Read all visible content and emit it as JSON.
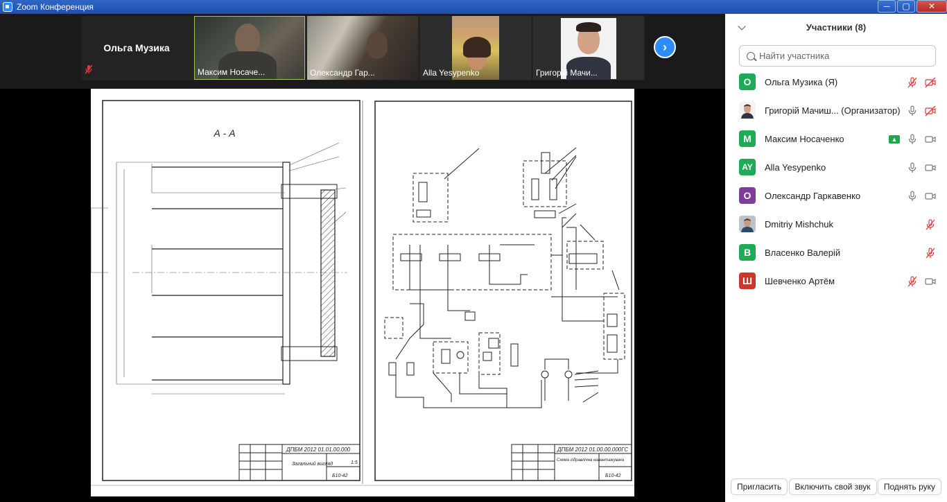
{
  "window": {
    "title": "Zoom Конференция",
    "min": "─",
    "max": "▢",
    "close": "✕"
  },
  "strip": {
    "self_name": "Ольга Музика",
    "tiles": [
      {
        "name": "Максим Носаче..."
      },
      {
        "name": "Олександр Гар..."
      },
      {
        "name": "Alla Yesypenko"
      },
      {
        "name": "Григорій Мачи..."
      }
    ],
    "next_arrow": "›"
  },
  "share": {
    "left_sheet": {
      "section_label": "А - А",
      "stamp_code": "ДПБМ 2012 01.01.00.000",
      "stamp_title": "Загальний вигляд",
      "stamp_scale": "1:5",
      "stamp_group": "Б10-42"
    },
    "right_sheet": {
      "stamp_code": "ДПБМ 2012 01.00.00.000ГС",
      "stamp_title": "Схема гідравлічна навантажувача",
      "stamp_group": "Б10-42"
    }
  },
  "panel": {
    "title": "Участники (8)",
    "search_placeholder": "Найти участника",
    "participants": [
      {
        "avatar_text": "О",
        "avatar_color": "#1fab55",
        "name": "Ольга Музика (Я)",
        "mic": "muted",
        "video": "off"
      },
      {
        "avatar_text": "",
        "avatar_color": "photo",
        "name": "Григорій Мачиш...  (Организатор)",
        "mic": "on",
        "video": "off"
      },
      {
        "avatar_text": "М",
        "avatar_color": "#1fab55",
        "name": "Максим Носаченко",
        "share": true,
        "mic": "on",
        "video": "on"
      },
      {
        "avatar_text": "AY",
        "avatar_color": "#1fab55",
        "name": "Alla Yesypenko",
        "mic": "on",
        "video": "on"
      },
      {
        "avatar_text": "О",
        "avatar_color": "#7f3d99",
        "name": "Олександр Гаркавенко",
        "mic": "on",
        "video": "on"
      },
      {
        "avatar_text": "",
        "avatar_color": "photo",
        "name": "Dmitriy Mishchuk",
        "mic": "muted",
        "video": "none"
      },
      {
        "avatar_text": "В",
        "avatar_color": "#1fab55",
        "name": "Власенко Валерій",
        "mic": "muted",
        "video": "none"
      },
      {
        "avatar_text": "Ш",
        "avatar_color": "#c8382b",
        "name": "Шевченко Артём",
        "mic": "muted",
        "video": "on"
      }
    ],
    "footer": {
      "invite": "Пригласить",
      "unmute": "Включить свой звук",
      "raise_hand": "Поднять руку"
    }
  },
  "colors": {
    "zoom_blue": "#2d8cff",
    "muted_red": "#e0383e",
    "share_green": "#21a54c"
  }
}
